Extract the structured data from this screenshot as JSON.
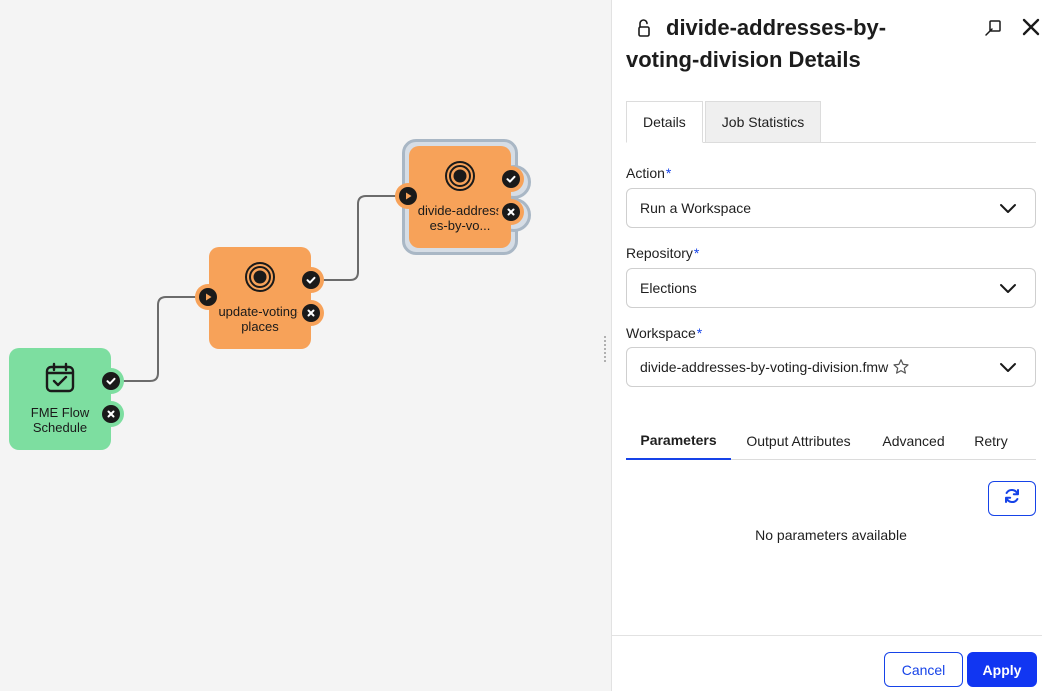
{
  "canvas": {
    "nodes": [
      {
        "label": "FME Flow Schedule",
        "type": "schedule",
        "color": "#7ddea0",
        "icon": "calendar-check-icon"
      },
      {
        "label": "update-voting-places",
        "type": "workspace",
        "color": "#f7a259",
        "icon": "target-icon"
      },
      {
        "label": "divide-addresses-by-vo...",
        "type": "workspace",
        "color": "#f7a259",
        "icon": "target-icon",
        "selected": true
      }
    ]
  },
  "panel": {
    "title": "divide-addresses-by-voting-division Details",
    "tabs": [
      {
        "label": "Details",
        "active": true
      },
      {
        "label": "Job Statistics",
        "active": false
      }
    ],
    "action": {
      "label": "Action",
      "required_mark": "*",
      "value": "Run a Workspace"
    },
    "repository": {
      "label": "Repository",
      "required_mark": "*",
      "value": "Elections"
    },
    "workspace": {
      "label": "Workspace",
      "required_mark": "*",
      "value": "divide-addresses-by-voting-division.fmw"
    },
    "subtabs": [
      {
        "label": "Parameters",
        "active": true
      },
      {
        "label": "Output Attributes",
        "active": false
      },
      {
        "label": "Advanced",
        "active": false
      },
      {
        "label": "Retry",
        "active": false
      }
    ],
    "empty_message": "No parameters available",
    "cancel_label": "Cancel",
    "apply_label": "Apply"
  },
  "colors": {
    "accent": "#1643e8",
    "apply_bg": "#1136f2",
    "schedule_node": "#7ddea0",
    "workspace_node": "#f7a259"
  }
}
